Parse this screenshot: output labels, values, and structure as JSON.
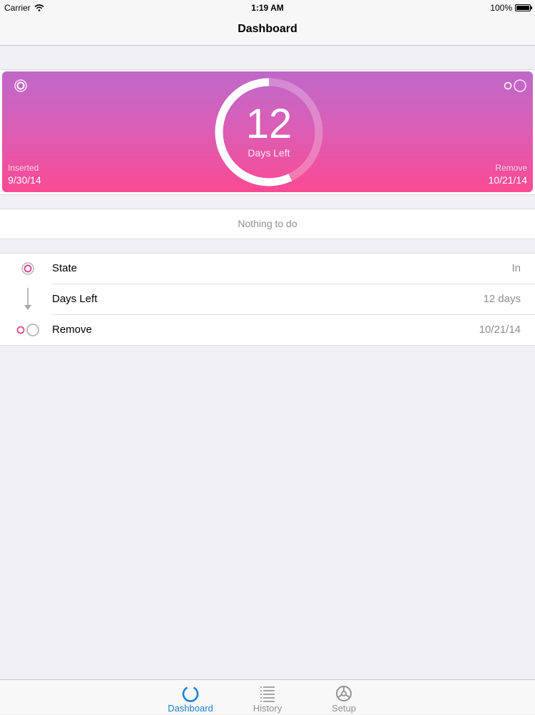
{
  "status_bar": {
    "carrier": "Carrier",
    "time": "1:19 AM",
    "battery": "100%"
  },
  "nav": {
    "title": "Dashboard"
  },
  "hero": {
    "days_count": "12",
    "days_label": "Days Left",
    "inserted_label": "Inserted",
    "inserted_date": "9/30/14",
    "remove_label": "Remove",
    "remove_date": "10/21/14",
    "progress_fraction": 0.57,
    "gradient_top": "#bf68c9",
    "gradient_bottom": "#fa4a93"
  },
  "todo": {
    "text": "Nothing to do"
  },
  "info": {
    "rows": [
      {
        "icon": "state-ring-icon",
        "label": "State",
        "value": "In"
      },
      {
        "icon": "arrow-down-icon",
        "label": "Days Left",
        "value": "12 days"
      },
      {
        "icon": "remove-rings-icon",
        "label": "Remove",
        "value": "10/21/14"
      }
    ]
  },
  "tabs": [
    {
      "icon": "dashboard-icon",
      "label": "Dashboard",
      "active": true
    },
    {
      "icon": "history-list-icon",
      "label": "History",
      "active": false
    },
    {
      "icon": "setup-icon",
      "label": "Setup",
      "active": false
    }
  ],
  "colors": {
    "accent": "#1d80d7",
    "pink": "#e8478f",
    "tab_inactive": "#929292"
  }
}
